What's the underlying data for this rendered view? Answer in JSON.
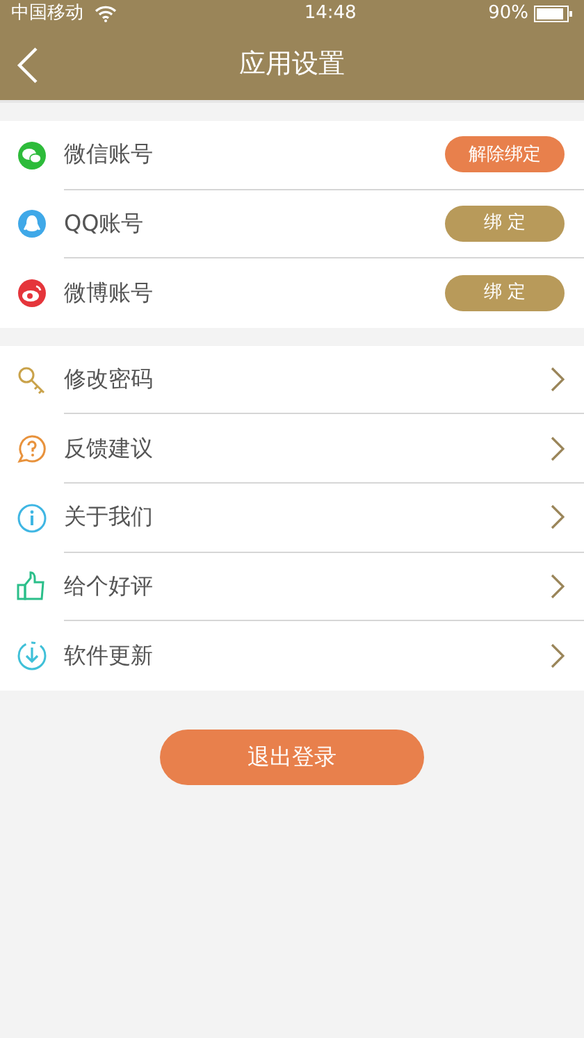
{
  "status_bar": {
    "carrier": "中国移动",
    "time": "14:48",
    "battery": "90%"
  },
  "nav": {
    "title": "应用设置"
  },
  "accounts": [
    {
      "kind": "wechat",
      "label": "微信账号",
      "bound": true,
      "action": "解除绑定"
    },
    {
      "kind": "qq",
      "label": "QQ账号",
      "bound": false,
      "action": "绑 定"
    },
    {
      "kind": "weibo",
      "label": "微博账号",
      "bound": false,
      "action": "绑 定"
    }
  ],
  "menu": [
    {
      "kind": "key",
      "label": "修改密码"
    },
    {
      "kind": "question",
      "label": "反馈建议"
    },
    {
      "kind": "info",
      "label": "关于我们"
    },
    {
      "kind": "thumb",
      "label": "给个好评"
    },
    {
      "kind": "download",
      "label": "软件更新"
    }
  ],
  "logout_button": "退出登录"
}
